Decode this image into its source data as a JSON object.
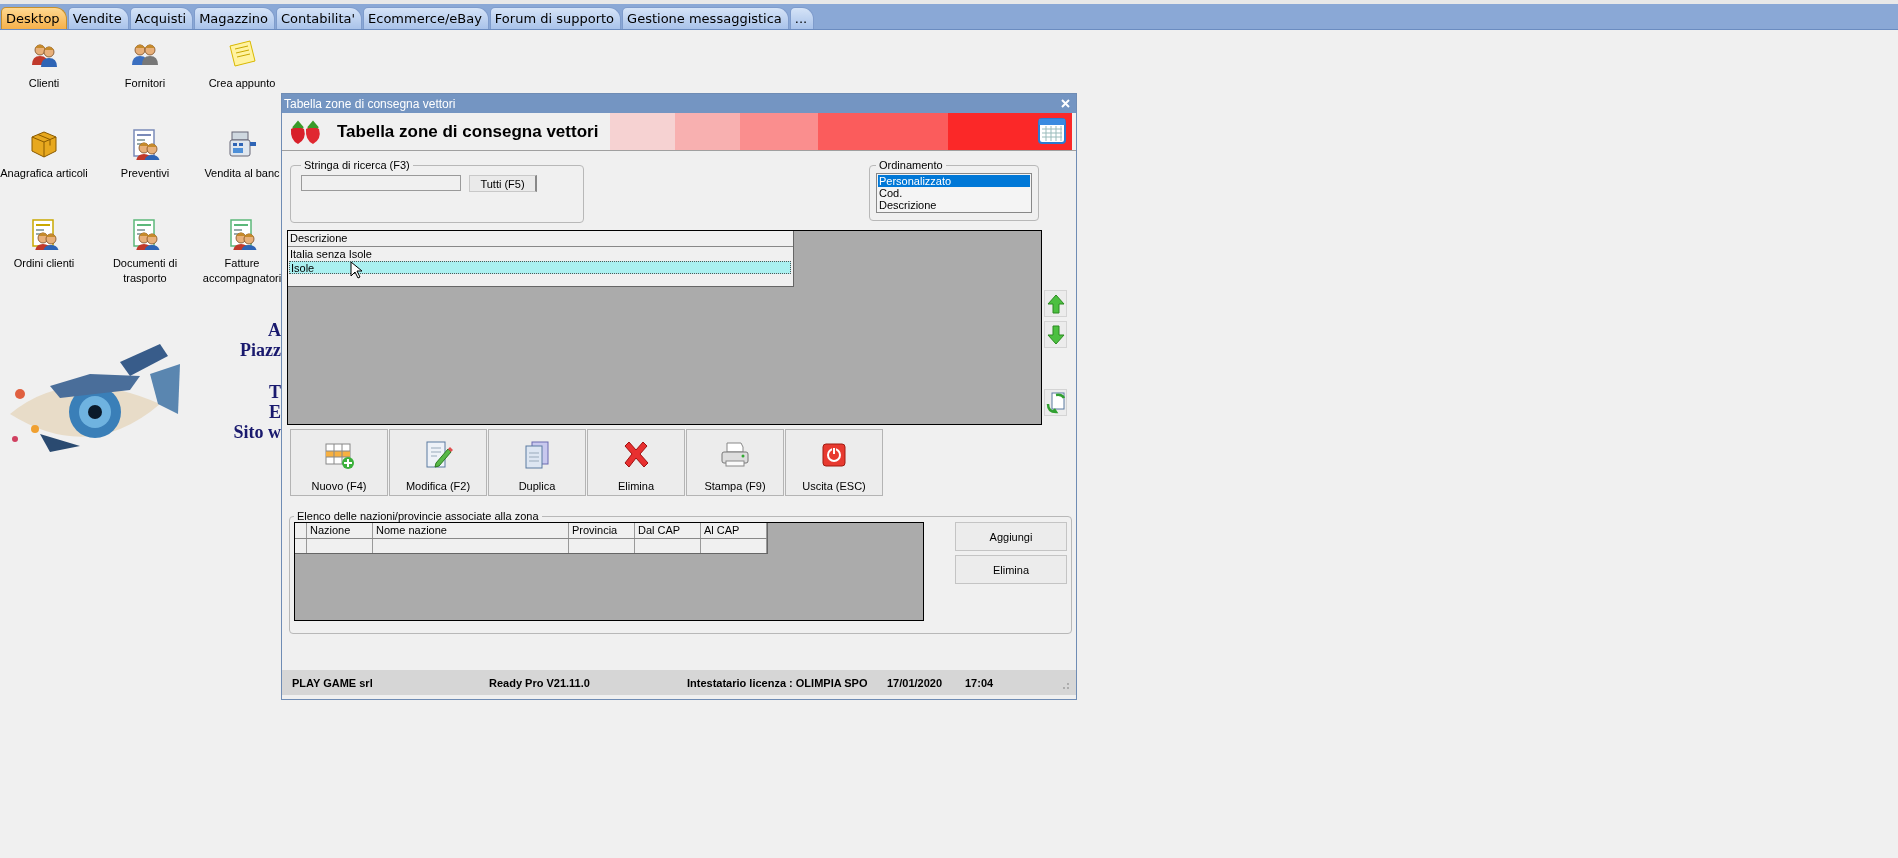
{
  "tabs": [
    {
      "label": "Desktop",
      "selected": true
    },
    {
      "label": "Vendite",
      "selected": false
    },
    {
      "label": "Acquisti",
      "selected": false
    },
    {
      "label": "Magazzino",
      "selected": false
    },
    {
      "label": "Contabilita'",
      "selected": false
    },
    {
      "label": "Ecommerce/eBay",
      "selected": false
    },
    {
      "label": "Forum di supporto",
      "selected": false
    },
    {
      "label": "Gestione messaggistica",
      "selected": false
    },
    {
      "label": "...",
      "selected": false
    }
  ],
  "desktop_icons": [
    {
      "label": "Clienti",
      "kind": "people"
    },
    {
      "label": "Fornitori",
      "kind": "business"
    },
    {
      "label": "Crea appunto",
      "kind": "note"
    },
    {
      "label": "Anagrafica articoli",
      "kind": "box"
    },
    {
      "label": "Preventivi",
      "kind": "doc"
    },
    {
      "label": "Vendita al banc",
      "kind": "register"
    },
    {
      "label": "Ordini clienti",
      "kind": "docyellow"
    },
    {
      "label": "Documenti di trasporto",
      "kind": "docgreen"
    },
    {
      "label": "Fatture accompagnatori",
      "kind": "docgreen"
    }
  ],
  "desktop_banner": {
    "kind": "picture",
    "texts": [
      "A",
      "Piazz",
      "T",
      "E",
      "Sito w"
    ]
  },
  "dialog": {
    "title": "Tabella zone di consegna vettori",
    "header_title": "Tabella zone di consegna vettori",
    "search": {
      "label": "Stringa di ricerca (F3)",
      "button": "Tutti (F5)"
    },
    "sorting": {
      "label": "Ordinamento",
      "options": [
        {
          "label": "Personalizzato",
          "selected": true
        },
        {
          "label": "Cod.",
          "selected": false
        },
        {
          "label": "Descrizione",
          "selected": false
        }
      ]
    },
    "zones_table": {
      "columns": [
        "Descrizione"
      ],
      "rows": [
        {
          "cells": [
            "Italia senza Isole"
          ],
          "selected": false
        },
        {
          "cells": [
            "Isole"
          ],
          "selected": true
        }
      ]
    },
    "toolbar": [
      {
        "label": "Nuovo (F4)",
        "kind": "new"
      },
      {
        "label": "Modifica (F2)",
        "kind": "edit"
      },
      {
        "label": "Duplica",
        "kind": "duplicate"
      },
      {
        "label": "Elimina",
        "kind": "delete"
      },
      {
        "label": "Stampa (F9)",
        "kind": "print"
      },
      {
        "label": "Uscita (ESC)",
        "kind": "exit"
      }
    ],
    "nations": {
      "label": "Elenco delle nazioni/provincie associate alla zona",
      "columns": [
        "Nazione",
        "Nome nazione",
        "Provincia",
        "Dal CAP",
        "Al CAP"
      ],
      "buttons": [
        "Aggiungi",
        "Elimina"
      ]
    },
    "status_bar": {
      "company": "PLAY GAME srl",
      "version": "Ready Pro V21.11.0",
      "license": "Intestatario licenza : OLIMPIA SPO",
      "date": "17/01/2020",
      "time": "17:04"
    }
  }
}
